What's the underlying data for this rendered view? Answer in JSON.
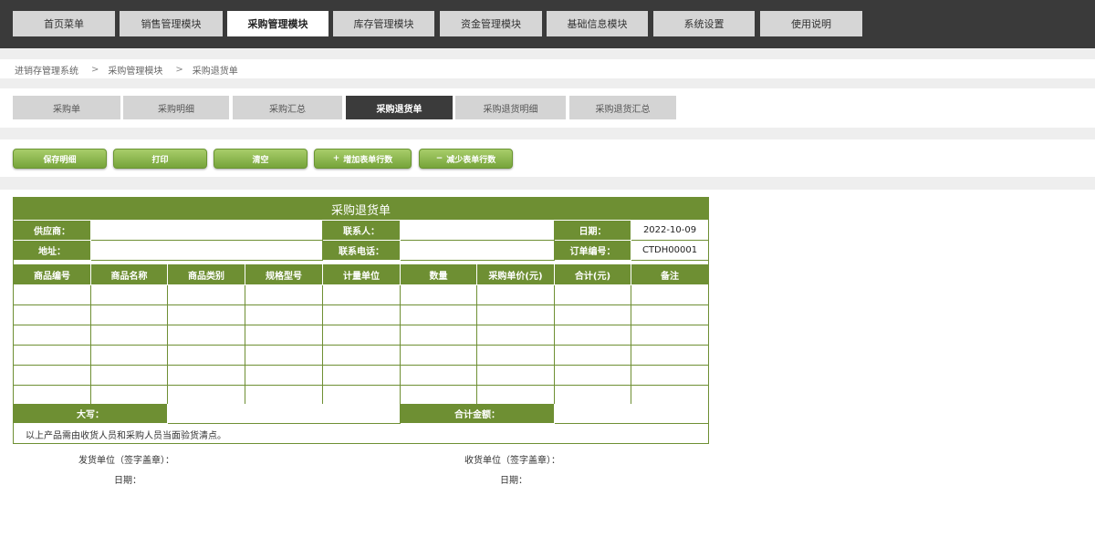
{
  "topnav": {
    "items": [
      {
        "label": "首页菜单",
        "active": false
      },
      {
        "label": "销售管理模块",
        "active": false
      },
      {
        "label": "采购管理模块",
        "active": true
      },
      {
        "label": "库存管理模块",
        "active": false
      },
      {
        "label": "资金管理模块",
        "active": false
      },
      {
        "label": "基础信息模块",
        "active": false
      },
      {
        "label": "系统设置",
        "active": false
      },
      {
        "label": "使用说明",
        "active": false
      }
    ]
  },
  "breadcrumb": {
    "items": [
      "进销存管理系统",
      "采购管理模块",
      "采购退货单"
    ],
    "separator": ">"
  },
  "tabs": {
    "items": [
      {
        "label": "采购单",
        "active": false
      },
      {
        "label": "采购明细",
        "active": false
      },
      {
        "label": "采购汇总",
        "active": false
      },
      {
        "label": "采购退货单",
        "active": true
      },
      {
        "label": "采购退货明细",
        "active": false
      },
      {
        "label": "采购退货汇总",
        "active": false
      }
    ]
  },
  "toolbar": {
    "save_label": "保存明细",
    "print_label": "打印",
    "clear_label": "清空",
    "add_rows_label": "增加表单行数",
    "add_rows_symbol": "+",
    "remove_rows_label": "减少表单行数",
    "remove_rows_symbol": "−"
  },
  "form": {
    "title": "采购退货单",
    "supplier_label": "供应商：",
    "supplier_value": "",
    "contact_label": "联系人：",
    "contact_value": "",
    "date_label": "日期：",
    "date_value": "2022-10-09",
    "address_label": "地址：",
    "address_value": "",
    "phone_label": "联系电话：",
    "phone_value": "",
    "order_no_label": "订单编号：",
    "order_no_value": "CTDH00001",
    "columns": [
      "商品编号",
      "商品名称",
      "商品类别",
      "规格型号",
      "计量单位",
      "数量",
      "采购单价(元)",
      "合计(元)",
      "备注"
    ],
    "rows": [
      [
        "",
        "",
        "",
        "",
        "",
        "",
        "",
        "",
        ""
      ],
      [
        "",
        "",
        "",
        "",
        "",
        "",
        "",
        "",
        ""
      ],
      [
        "",
        "",
        "",
        "",
        "",
        "",
        "",
        "",
        ""
      ],
      [
        "",
        "",
        "",
        "",
        "",
        "",
        "",
        "",
        ""
      ],
      [
        "",
        "",
        "",
        "",
        "",
        "",
        "",
        "",
        ""
      ],
      [
        "",
        "",
        "",
        "",
        "",
        "",
        "",
        "",
        ""
      ]
    ],
    "capital_label": "大写：",
    "capital_value": "",
    "total_label": "合计金额：",
    "total_value": "",
    "note": "以上产品需由收货人员和采购人员当面验货清点。"
  },
  "signature": {
    "sender_unit_label": "发货单位（签字盖章）：",
    "sender_date_label": "日期：",
    "receiver_unit_label": "收货单位（签字盖章）：",
    "receiver_date_label": "日期："
  },
  "colors": {
    "nav_bg": "#3a3a3a",
    "accent_green": "#6e8f33",
    "button_green": "#8ab54a",
    "active_tab": "#3b3b3b"
  }
}
